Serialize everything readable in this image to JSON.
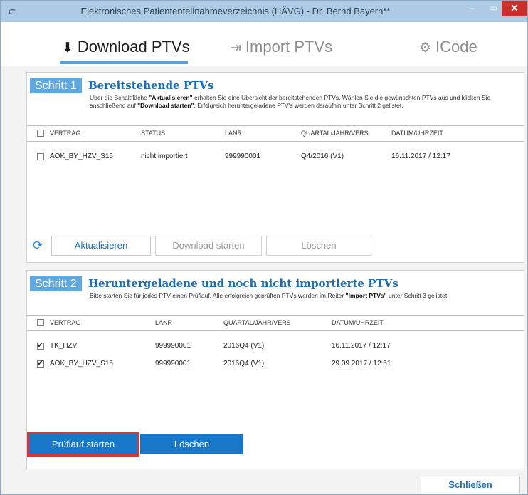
{
  "window": {
    "title": "Elektronisches Patiententeilnahmeverzeichnis (HÄVG) - Dr. Bernd Bayern**",
    "app_icon": "app-logo-icon",
    "minimize_glyph": "–",
    "maximize_glyph": "▭",
    "close_glyph": "✕"
  },
  "tabs": [
    {
      "label": "Download PTVs",
      "icon": "download-icon",
      "glyph": "⬇",
      "active": true
    },
    {
      "label": "Import PTVs",
      "icon": "import-icon",
      "glyph": "⇥",
      "active": false
    },
    {
      "label": "ICode",
      "icon": "gear-icon",
      "glyph": "⚙",
      "active": false
    }
  ],
  "step1": {
    "badge": "Schritt 1",
    "title": "Bereitstehende PTVs",
    "desc_part1": "Über die Schaltfläche ",
    "desc_bold1": "\"Aktualisieren\"",
    "desc_part2": " erhalten Sie eine Übersicht der bereitstehenden PTVs. Wählen Sie die gewünschten PTVs aus und klicken Sie anschließend auf ",
    "desc_bold2": "\"Download starten\"",
    "desc_part3": ". Erfolgreich heruntergeladene PTV's werden daraufhin unter Schritt 2 gelistet.",
    "columns": [
      "VERTRAG",
      "STATUS",
      "LANR",
      "QUARTAL/JAHR/VERS",
      "DATUM/UHRZEIT"
    ],
    "rows": [
      {
        "checked": false,
        "vertrag": "AOK_BY_HZV_S15",
        "status": "nicht importiert",
        "lanr": "999990001",
        "quartal": "Q4/2016 (V1)",
        "datum": "16.11.2017 / 12:17"
      }
    ],
    "buttons": {
      "refresh": "Aktualisieren",
      "download": "Download starten",
      "delete": "Löschen"
    }
  },
  "step2": {
    "badge": "Schritt 2",
    "title": "Heruntergeladene und noch nicht importierte PTVs",
    "desc_part1": "Bitte starten Sie für jedes PTV einen Prüflauf. Alle erfolgreich geprüften PTVs werden im Reiter ",
    "desc_bold1": "\"Import PTVs\"",
    "desc_part2": " unter Schritt 3 gelistet.",
    "columns": [
      "VERTRAG",
      "LANR",
      "QUARTAL/JAHR/VERS",
      "DATUM/UHRZEIT"
    ],
    "rows": [
      {
        "checked": true,
        "vertrag": "TK_HZV",
        "lanr": "999990001",
        "quartal": "2016Q4 (V1)",
        "datum": "16.11.2017 / 12:17"
      },
      {
        "checked": true,
        "vertrag": "AOK_BY_HZV_S15",
        "lanr": "999990001",
        "quartal": "2016Q4 (V1)",
        "datum": "29.09.2017 / 12:51"
      }
    ],
    "buttons": {
      "check": "Prüflauf starten",
      "delete": "Löschen"
    }
  },
  "footer": {
    "close": "Schließen"
  },
  "colors": {
    "accent": "#1877c8",
    "highlight": "#e23333",
    "titlebar": "#aecbe6"
  }
}
